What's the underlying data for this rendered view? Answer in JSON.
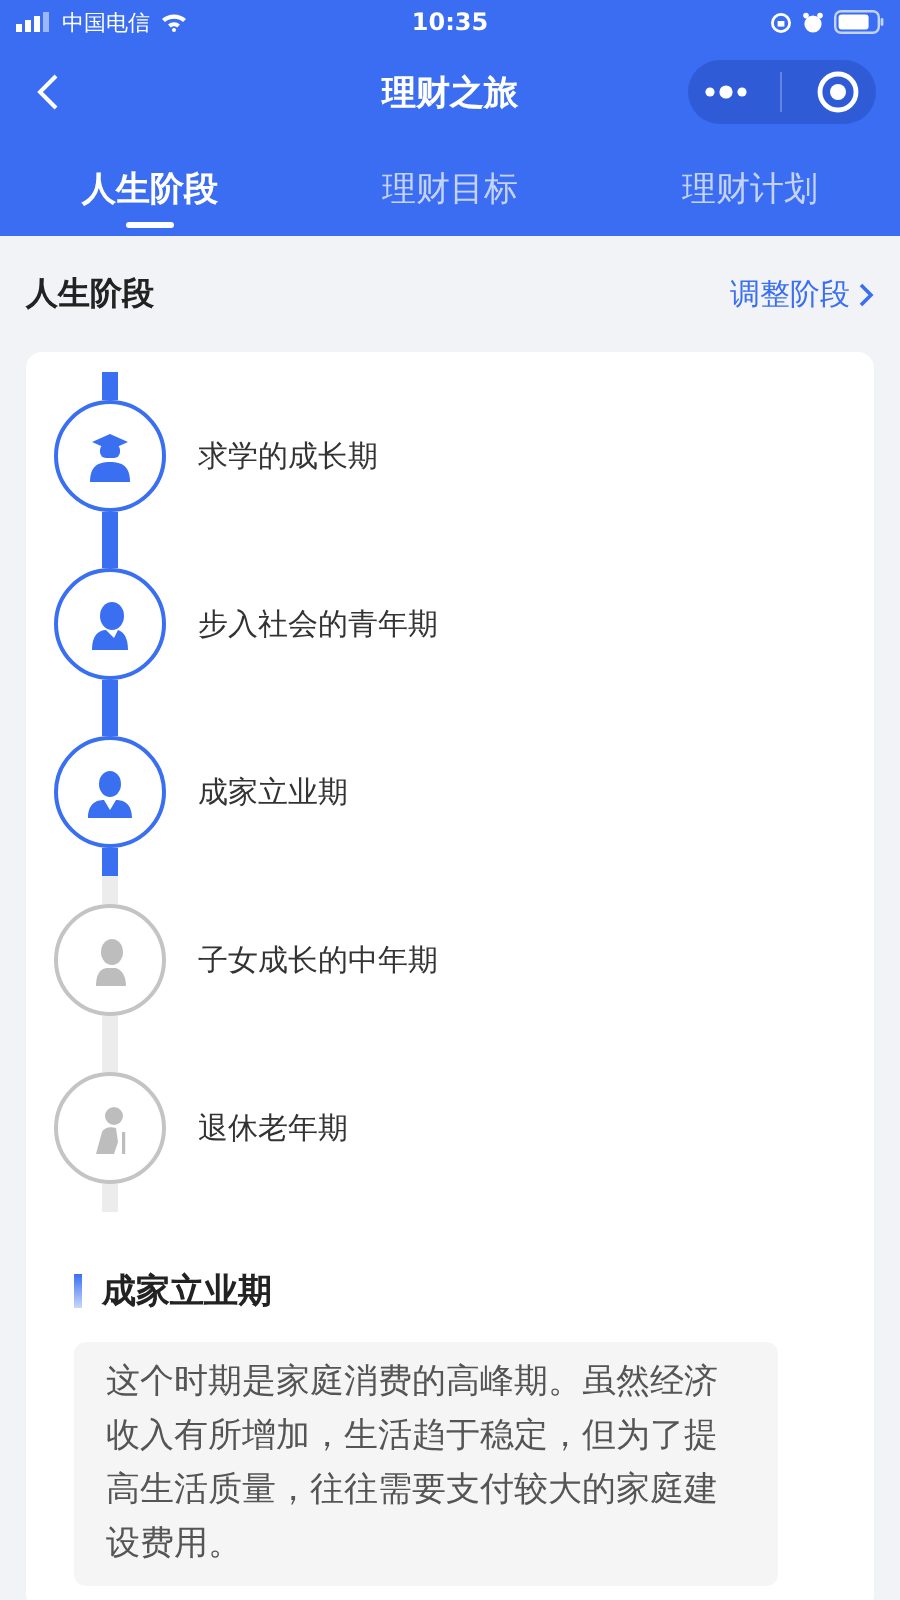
{
  "status_bar": {
    "carrier": "中国电信",
    "time": "10:35"
  },
  "nav": {
    "title": "理财之旅"
  },
  "tabs": [
    {
      "label": "人生阶段",
      "selected": true
    },
    {
      "label": "理财目标",
      "selected": false
    },
    {
      "label": "理财计划",
      "selected": false
    }
  ],
  "section": {
    "title": "人生阶段",
    "action": "调整阶段"
  },
  "stages": [
    {
      "label": "求学的成长期",
      "reached": true
    },
    {
      "label": "步入社会的青年期",
      "reached": true
    },
    {
      "label": "成家立业期",
      "reached": true
    },
    {
      "label": "子女成长的中年期",
      "reached": false
    },
    {
      "label": "退休老年期",
      "reached": false
    }
  ],
  "detail": {
    "title": "成家立业期",
    "text": "这个时期是家庭消费的高峰期。虽然经济收入有所增加，生活趋于稳定，但为了提高生活质量，往往需要支付较大的家庭建设费用。"
  }
}
